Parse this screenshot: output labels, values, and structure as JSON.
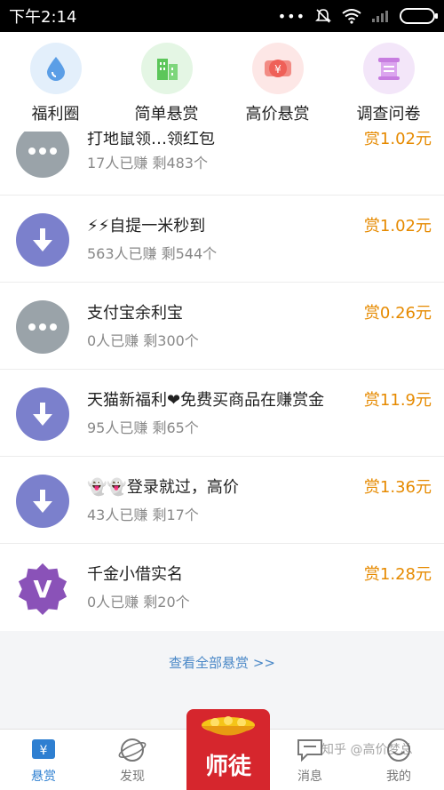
{
  "status_bar": {
    "time": "下午2:14",
    "dots": "•••"
  },
  "categories": [
    {
      "label": "福利圈",
      "icon": "water-drop-icon",
      "color": "#5b9ee6",
      "bg": "#e3effb"
    },
    {
      "label": "简单悬赏",
      "icon": "buildings-icon",
      "color": "#5cc65a",
      "bg": "#e4f6e4"
    },
    {
      "label": "高价悬赏",
      "icon": "money-icon",
      "color": "#ef6058",
      "bg": "#fde7e6"
    },
    {
      "label": "调查问卷",
      "icon": "scroll-icon",
      "color": "#c77de0",
      "bg": "#f3e6f9"
    }
  ],
  "tasks": [
    {
      "title": "打地鼠领…领红包",
      "stats": "17人已赚  剩483个",
      "reward": "赏1.02元",
      "icon": "more-dots-icon"
    },
    {
      "title": "⚡⚡自提一米秒到",
      "stats": "563人已赚  剩544个",
      "reward": "赏1.02元",
      "icon": "download-icon"
    },
    {
      "title": "支付宝余利宝",
      "stats": "0人已赚  剩300个",
      "reward": "赏0.26元",
      "icon": "more-dots-icon"
    },
    {
      "title": "天猫新福利❤免费买商品在赚赏金",
      "stats": "95人已赚  剩65个",
      "reward": "赏11.9元",
      "icon": "download-icon"
    },
    {
      "title": "👻👻登录就过，高价",
      "stats": "43人已赚  剩17个",
      "reward": "赏1.36元",
      "icon": "download-icon"
    },
    {
      "title": "千金小借实名",
      "stats": "0人已赚  剩20个",
      "reward": "赏1.28元",
      "icon": "v-badge-icon"
    }
  ],
  "view_all": "查看全部悬赏 >>",
  "nav": {
    "reward": "悬赏",
    "discover": "发现",
    "center": "师徒",
    "messages": "消息",
    "me": "我的"
  },
  "watermark": "知乎 @高价梦总",
  "colors": {
    "accent": "#2e7fd1",
    "reward": "#e68a00",
    "center_btn": "#d6262d"
  }
}
